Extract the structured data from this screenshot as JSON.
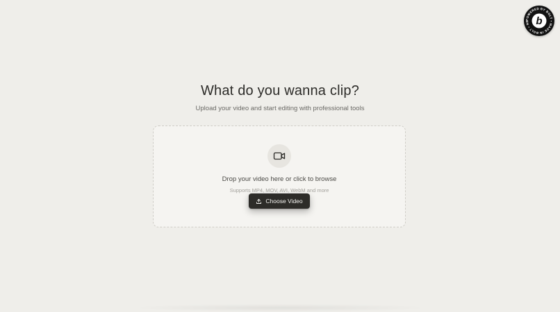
{
  "badge": {
    "icon": "bolt-b-logo-icon",
    "text": "POWERED BY BOLT • MADE IN BOLT • NEW"
  },
  "hero": {
    "title": "What do you wanna clip?",
    "subtitle": "Upload your video and start editing with professional tools"
  },
  "upload": {
    "icon": "video-camera-icon",
    "prompt": "Drop your video here or click to browse",
    "formats": "Supports MP4, MOV, AVI, WebM and more",
    "button_icon": "upload-icon",
    "button_label": "Choose Video"
  },
  "colors": {
    "background": "#efeeea",
    "dropzone": "#f5f4f1",
    "button": "#2d2c29",
    "badge": "#111111"
  }
}
